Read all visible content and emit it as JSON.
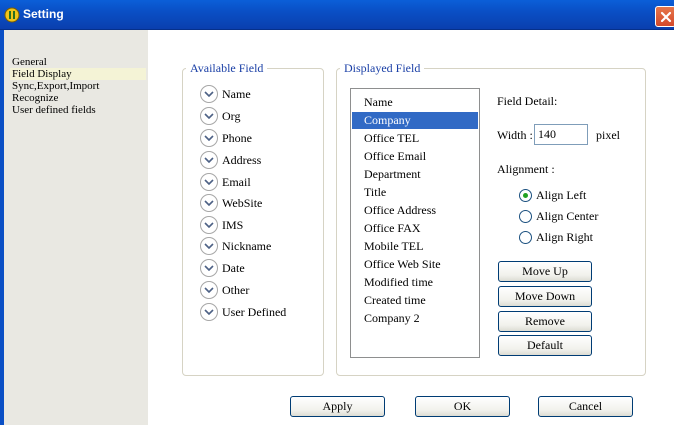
{
  "window": {
    "title": "Setting"
  },
  "sidebar": {
    "items": [
      {
        "label": "General"
      },
      {
        "label": "Field Display"
      },
      {
        "label": "Sync,Export,Import"
      },
      {
        "label": "Recognize"
      },
      {
        "label": "User defined fields"
      }
    ],
    "selected": "Field Display"
  },
  "available": {
    "legend": "Available Field",
    "items": [
      "Name",
      "Org",
      "Phone",
      "Address",
      "Email",
      "WebSite",
      "IMS",
      "Nickname",
      "Date",
      "Other",
      "User Defined"
    ]
  },
  "displayed": {
    "legend": "Displayed Field",
    "items": [
      "Name",
      "Company",
      "Office TEL",
      "Office Email",
      "Department",
      "Title",
      "Office Address",
      "Office FAX",
      "Mobile TEL",
      "Office Web Site",
      "Modified time",
      "Created time",
      "Company 2"
    ],
    "selected": "Company"
  },
  "detail": {
    "heading": "Field Detail:",
    "width_label": "Width :",
    "width_value": "140",
    "unit": "pixel",
    "alignment_label": "Alignment :",
    "align_left": "Align Left",
    "align_center": "Align Center",
    "align_right": "Align Right",
    "selected_alignment": "Align Left"
  },
  "buttons": {
    "move_up": "Move Up",
    "move_down": "Move Down",
    "remove": "Remove",
    "default": "Default",
    "apply": "Apply",
    "ok": "OK",
    "cancel": "Cancel"
  },
  "colors": {
    "titlebar": "#0a4fc5",
    "selection": "#316ac5",
    "legend_text": "#1a3fa6",
    "close_button": "#d4492a"
  }
}
